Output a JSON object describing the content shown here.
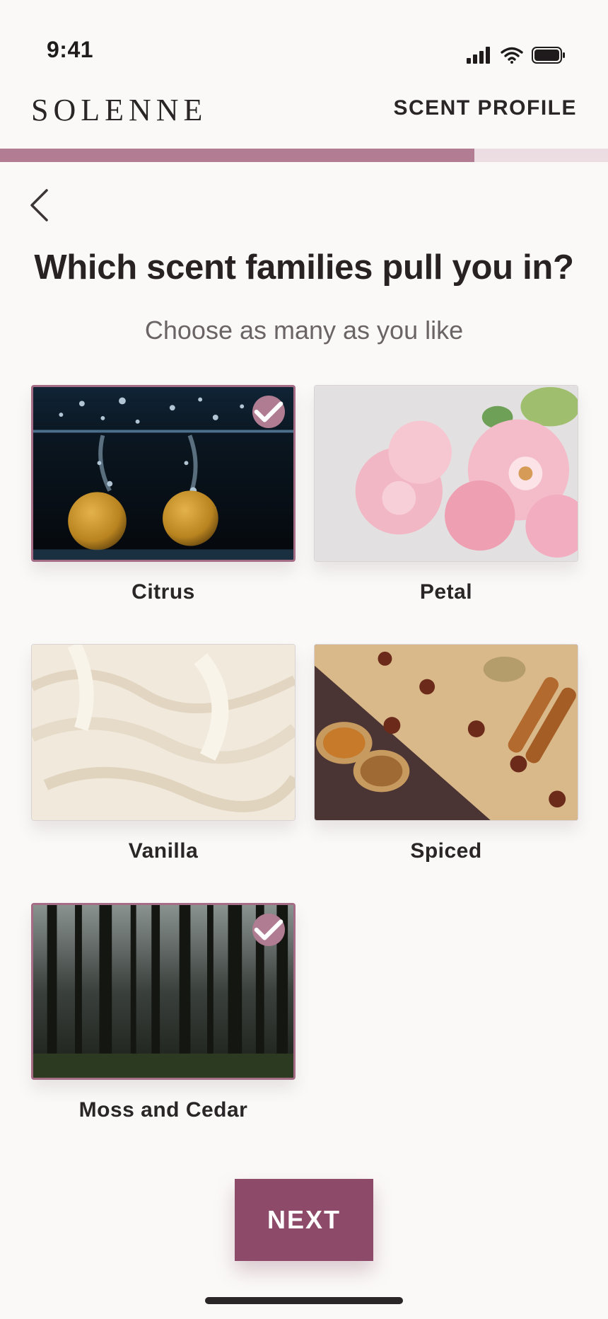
{
  "status": {
    "time": "9:41"
  },
  "header": {
    "logo": "SOLENNE",
    "section_label": "SCENT PROFILE"
  },
  "progress": {
    "fraction": 0.78
  },
  "question": {
    "title": "Which scent families pull you in?",
    "subtitle": "Choose as many as you like"
  },
  "options": [
    {
      "label": "Citrus",
      "selected": true
    },
    {
      "label": "Petal",
      "selected": false
    },
    {
      "label": "Vanilla",
      "selected": false
    },
    {
      "label": "Spiced",
      "selected": false
    },
    {
      "label": "Moss and Cedar",
      "selected": true
    }
  ],
  "footer": {
    "next_label": "NEXT"
  },
  "colors": {
    "accent": "#8e4b69",
    "progress": "#b27d93",
    "progress_track": "#ecdde3",
    "check": "#b07c92"
  },
  "icons": {
    "back": "chevron-left-icon",
    "check": "checkmark-icon",
    "signal": "cellular-signal-icon",
    "wifi": "wifi-icon",
    "battery": "battery-icon"
  }
}
